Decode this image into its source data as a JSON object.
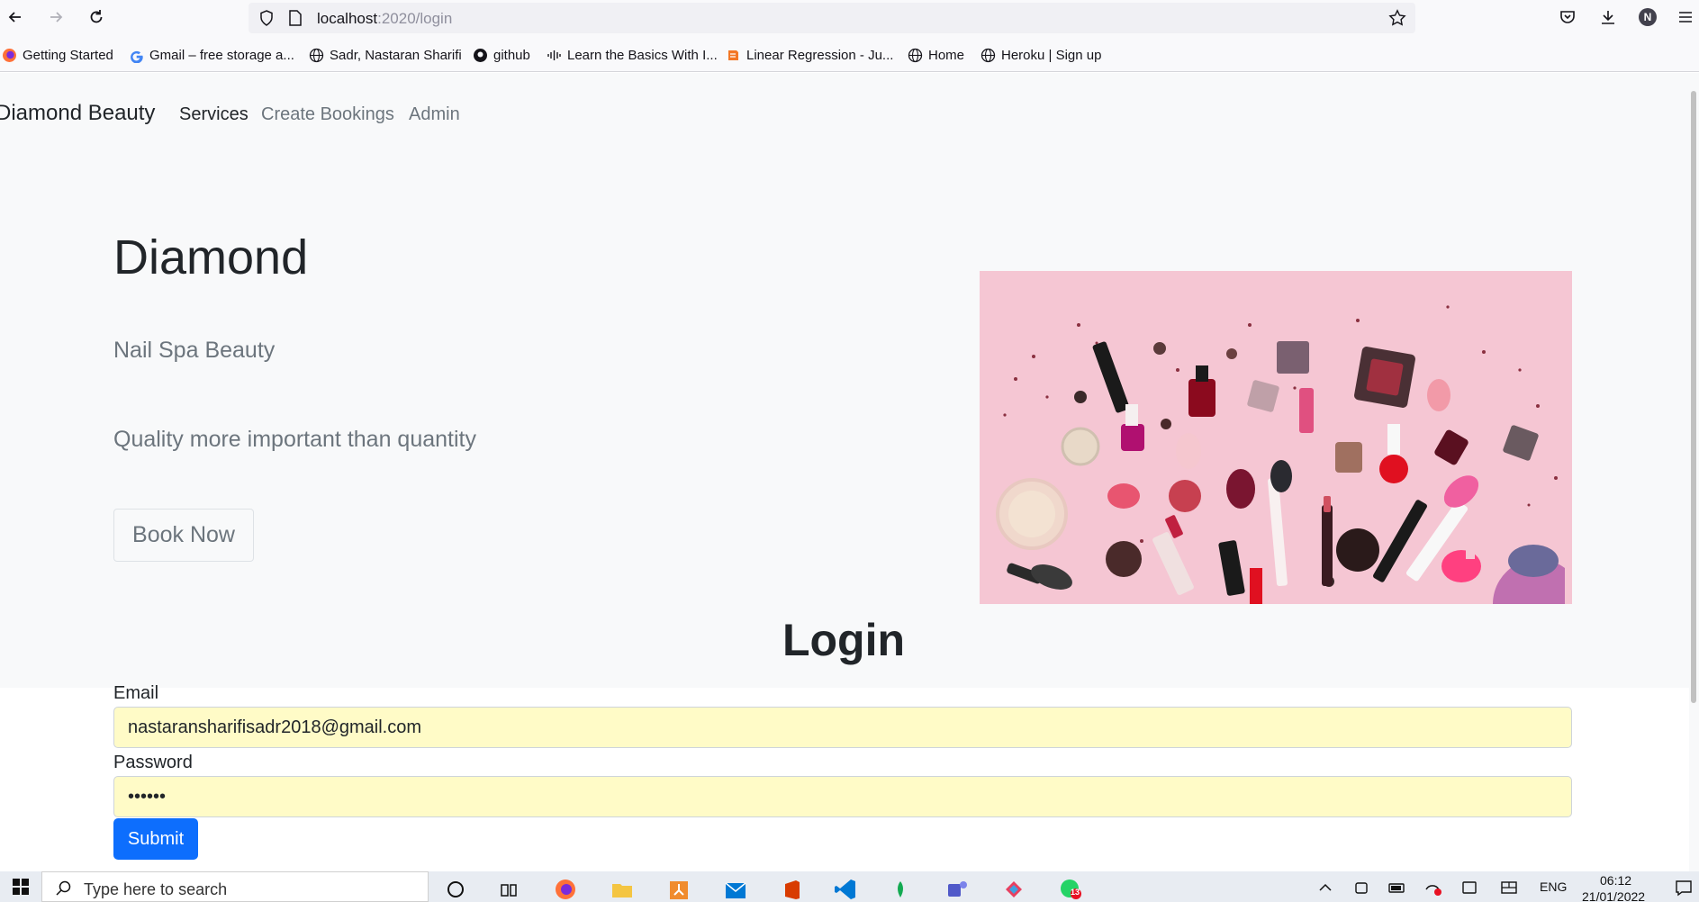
{
  "browser": {
    "url_host": "localhost",
    "url_path": ":2020/login",
    "profile_initial": "N",
    "bookmarks": [
      {
        "label": "Getting Started",
        "icon": "firefox-icon"
      },
      {
        "label": "Gmail – free storage a...",
        "icon": "google-icon"
      },
      {
        "label": "Sadr, Nastaran Sharifi",
        "icon": "globe-icon"
      },
      {
        "label": "github",
        "icon": "github-icon"
      },
      {
        "label": "Learn the Basics With I...",
        "icon": "cisco-icon"
      },
      {
        "label": "Linear Regression - Ju...",
        "icon": "jupyter-icon"
      },
      {
        "label": "Home",
        "icon": "globe-icon"
      },
      {
        "label": "Heroku | Sign up",
        "icon": "globe-icon"
      }
    ]
  },
  "site": {
    "brand": "Diamond Beauty",
    "nav": [
      "Services",
      "Create Bookings",
      "Admin"
    ]
  },
  "hero": {
    "title": "Diamond",
    "subtitle": "Nail Spa Beauty",
    "tagline": "Quality more important than quantity",
    "button": "Book Now",
    "image": "cosmetics-flatlay-image"
  },
  "login": {
    "title": "Login",
    "email_label": "Email",
    "email_value": "nastaransharifisadr2018@gmail.com",
    "password_label": "Password",
    "password_value": "••••••",
    "submit": "Submit"
  },
  "taskbar": {
    "search_placeholder": "Type here to search",
    "language": "ENG",
    "time": "06:12",
    "date": "21/01/2022",
    "badge_count": "13"
  },
  "colors": {
    "primary": "#0d6efd",
    "autofill": "#fffbc7",
    "hero_bg": "#f8f9fa",
    "image_bg": "#f5c6d3"
  }
}
